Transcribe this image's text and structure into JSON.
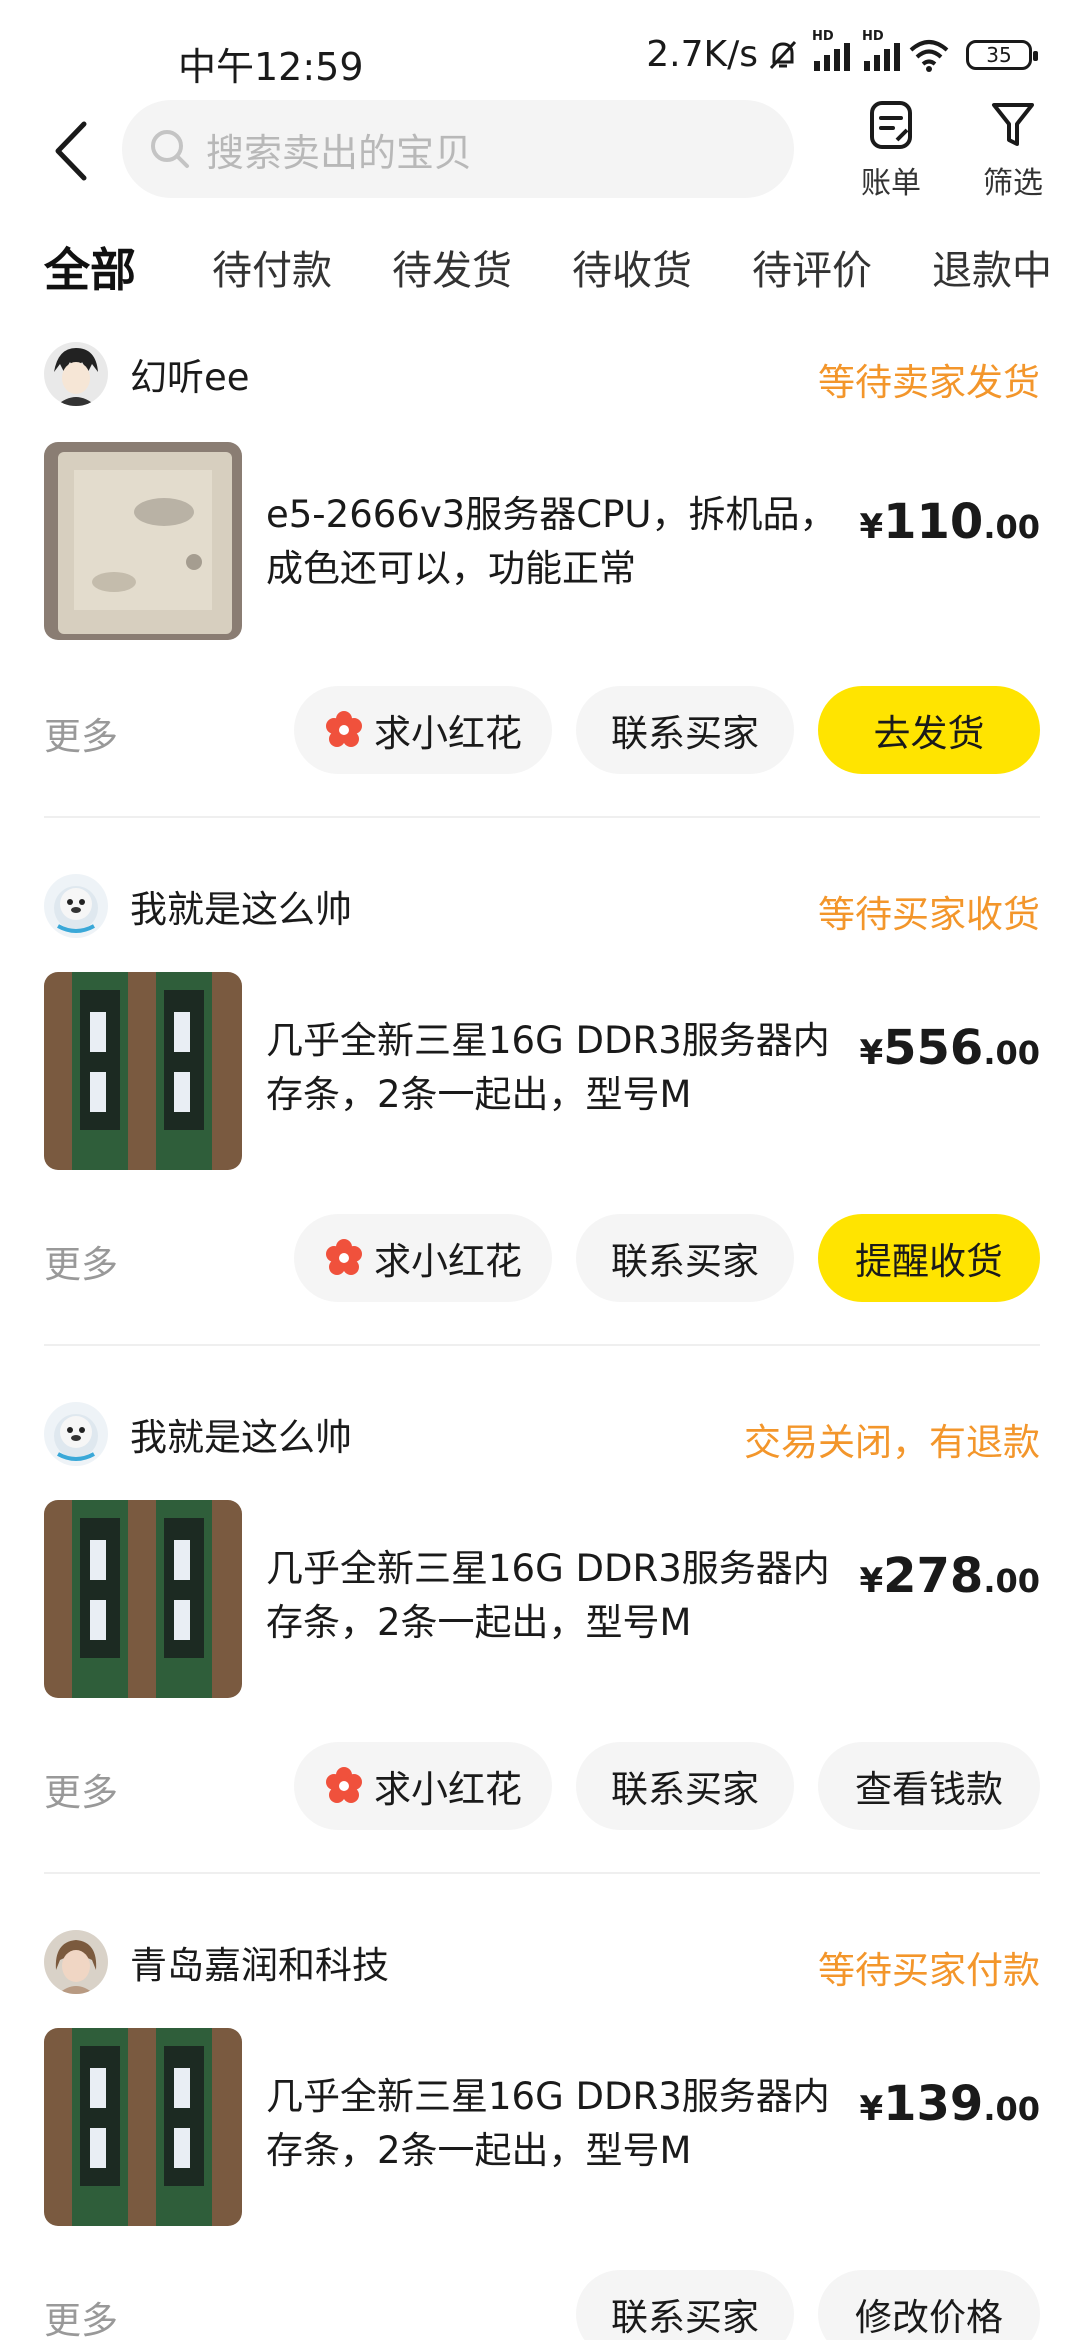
{
  "status_bar": {
    "time": "中午12:59",
    "net_speed": "2.7K/s",
    "hd1": "HD",
    "hd2": "HD",
    "battery": "35"
  },
  "header": {
    "search_placeholder": "搜索卖出的宝贝",
    "bill_label": "账单",
    "filter_label": "筛选"
  },
  "tabs": [
    "全部",
    "待付款",
    "待发货",
    "待收货",
    "待评价",
    "退款中"
  ],
  "colors": {
    "accent": "#ffe400",
    "status": "#f3962b",
    "flower": "#f0513c"
  },
  "orders": [
    {
      "seller": "幻听ee",
      "status": "等待卖家发货",
      "title_line1": "e5-2666v3服务器CPU，拆机品，",
      "title_line2": "成色还可以，功能正常",
      "price_currency": "¥",
      "price_int": "110",
      "price_dec": ".00",
      "more": "更多",
      "btn1": "求小红花",
      "btn2": "联系买家",
      "btn3": "去发货"
    },
    {
      "seller": "我就是这么帅",
      "status": "等待买家收货",
      "title_line1": "几乎全新三星16G DDR3服务器内",
      "title_line2": "存条，2条一起出，型号M",
      "price_currency": "¥",
      "price_int": "556",
      "price_dec": ".00",
      "more": "更多",
      "btn1": "求小红花",
      "btn2": "联系买家",
      "btn3": "提醒收货"
    },
    {
      "seller": "我就是这么帅",
      "status": "交易关闭，有退款",
      "title_line1": "几乎全新三星16G DDR3服务器内",
      "title_line2": "存条，2条一起出，型号M",
      "price_currency": "¥",
      "price_int": "278",
      "price_dec": ".00",
      "more": "更多",
      "btn1": "求小红花",
      "btn2": "联系买家",
      "btn3": "查看钱款"
    },
    {
      "seller": "青岛嘉润和科技",
      "status": "等待买家付款",
      "title_line1": "几乎全新三星16G DDR3服务器内",
      "title_line2": "存条，2条一起出，型号M",
      "price_currency": "¥",
      "price_int": "139",
      "price_dec": ".00",
      "more": "更多",
      "btn2": "联系买家",
      "btn3": "修改价格"
    }
  ]
}
